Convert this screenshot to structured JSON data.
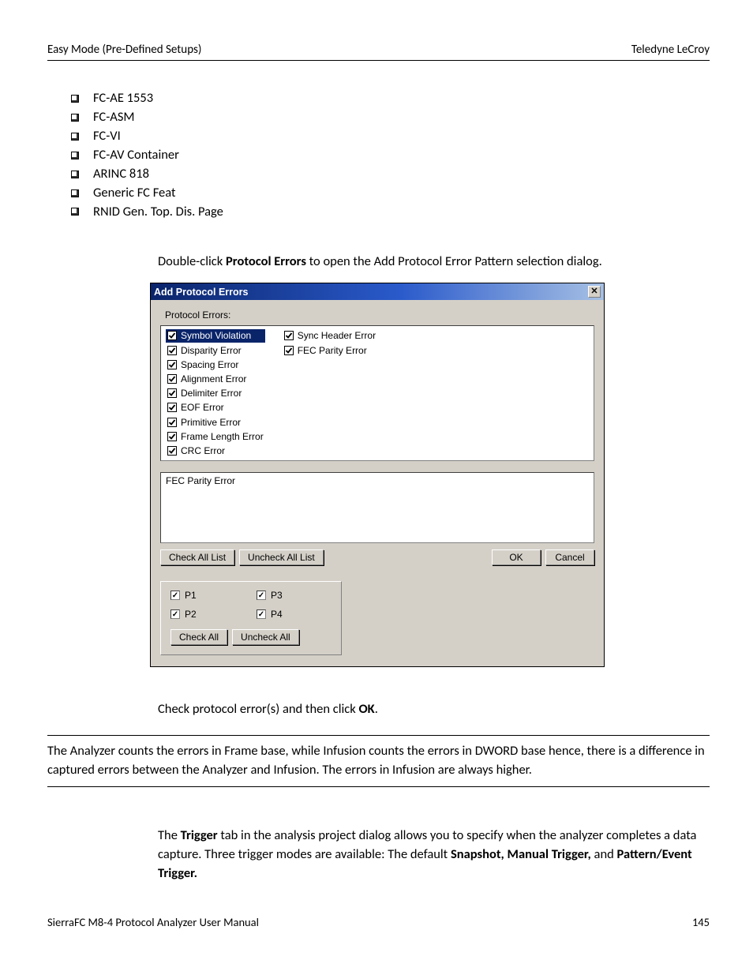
{
  "header": {
    "left": "Easy Mode (Pre-Defined Setups)",
    "right": "Teledyne  LeCroy"
  },
  "bullets": [
    "FC-AE 1553",
    "FC-ASM",
    "FC-VI",
    "FC-AV Container",
    "ARINC 818",
    "Generic FC Feat",
    "RNID Gen. Top. Dis. Page"
  ],
  "para1": {
    "pre": "Double-click ",
    "b": "Protocol Errors",
    "post": " to open the Add Protocol Error Pattern selection dialog."
  },
  "dialog": {
    "title": "Add Protocol Errors",
    "label": "Protocol Errors:",
    "col1": [
      {
        "label": "Symbol Violation",
        "checked": true,
        "selected": true
      },
      {
        "label": "Disparity Error",
        "checked": true
      },
      {
        "label": "Spacing Error",
        "checked": true
      },
      {
        "label": "Alignment Error",
        "checked": true
      },
      {
        "label": "Delimiter Error",
        "checked": true
      },
      {
        "label": "EOF Error",
        "checked": true
      },
      {
        "label": "Primitive Error",
        "checked": true
      },
      {
        "label": "Frame Length Error",
        "checked": true
      },
      {
        "label": "CRC Error",
        "checked": true
      }
    ],
    "col2": [
      {
        "label": "Sync Header Error",
        "checked": true
      },
      {
        "label": "FEC Parity Error",
        "checked": true
      }
    ],
    "desc": "FEC Parity Error",
    "buttons": {
      "checkAllList": "Check All List",
      "uncheckAllList": "Uncheck All List",
      "ok": "OK",
      "cancel": "Cancel"
    },
    "p": {
      "p1": "P1",
      "p2": "P2",
      "p3": "P3",
      "p4": "P4",
      "checkAll": "Check All",
      "uncheckAll": "Uncheck All"
    }
  },
  "para2": {
    "pre": "Check protocol error(s) and then click ",
    "b": "OK",
    "post": "."
  },
  "note": "The Analyzer counts the errors in Frame base, while Infusion counts the errors in DWORD base hence, there is a difference in captured errors between the Analyzer and Infusion. The errors in Infusion are always higher.",
  "para3": {
    "pre": "The ",
    "b1": "Trigger",
    "mid": " tab in the analysis project dialog allows you to specify when the analyzer completes a data capture. Three trigger modes are available: The default ",
    "b2": "Snapshot, Manual Trigger,",
    "mid2": " and ",
    "b3": "Pattern/Event Trigger."
  },
  "footer": {
    "left": "SierraFC M8-4 Protocol Analyzer User Manual",
    "right": "145"
  }
}
